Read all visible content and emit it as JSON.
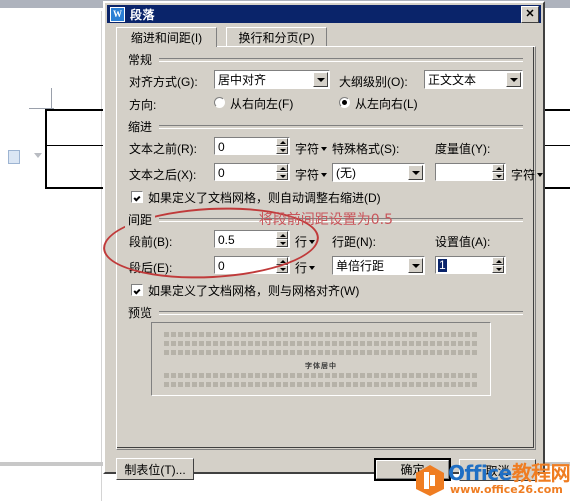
{
  "window": {
    "title": "段落",
    "icon": "word-icon",
    "close_label": "✕"
  },
  "tabs": [
    {
      "label": "缩进和间距(I)",
      "active": true
    },
    {
      "label": "换行和分页(P)",
      "active": false
    }
  ],
  "groups": {
    "general": {
      "label": "常规",
      "alignment": {
        "label": "对齐方式(G):",
        "value": "居中对齐"
      },
      "outline_level": {
        "label": "大纲级别(O):",
        "value": "正文文本"
      },
      "direction": {
        "label": "方向:",
        "options": [
          {
            "label": "从右向左(F)",
            "selected": false
          },
          {
            "label": "从左向右(L)",
            "selected": true
          }
        ]
      }
    },
    "indentation": {
      "label": "缩进",
      "before_text": {
        "label": "文本之前(R):",
        "value": "0",
        "unit": "字符"
      },
      "after_text": {
        "label": "文本之后(X):",
        "value": "0",
        "unit": "字符"
      },
      "special": {
        "label": "特殊格式(S):",
        "value": "(无)"
      },
      "by": {
        "label": "度量值(Y):",
        "value": "",
        "unit": "字符"
      },
      "auto_adjust": {
        "label": "如果定义了文档网格，则自动调整右缩进(D)",
        "checked": true
      }
    },
    "spacing": {
      "label": "间距",
      "before": {
        "label": "段前(B):",
        "value": "0.5",
        "unit": "行"
      },
      "after": {
        "label": "段后(E):",
        "value": "0",
        "unit": "行"
      },
      "line_spacing": {
        "label": "行距(N):",
        "value": "单倍行距"
      },
      "at": {
        "label": "设置值(A):",
        "value": "1",
        "selected": true
      },
      "snap_to_grid": {
        "label": "如果定义了文档网格，则与网格对齐(W)",
        "checked": true
      }
    },
    "preview": {
      "label": "预览",
      "sample_center_text": "字体居中",
      "lines_above": 3,
      "lines_below": 2
    }
  },
  "buttons": {
    "tabs_button": "制表位(T)...",
    "ok": "确定",
    "cancel": "取消"
  },
  "annotation": {
    "text": "将段前间距设置为0.5",
    "color": "#c9555b",
    "ellipse_color": "#c03a3a"
  },
  "watermark": {
    "brand_primary": "Office",
    "brand_secondary": "教程网",
    "url": "www.office26.com",
    "icon_color": "#ef7d22",
    "text_color": "#1f6fc4"
  }
}
